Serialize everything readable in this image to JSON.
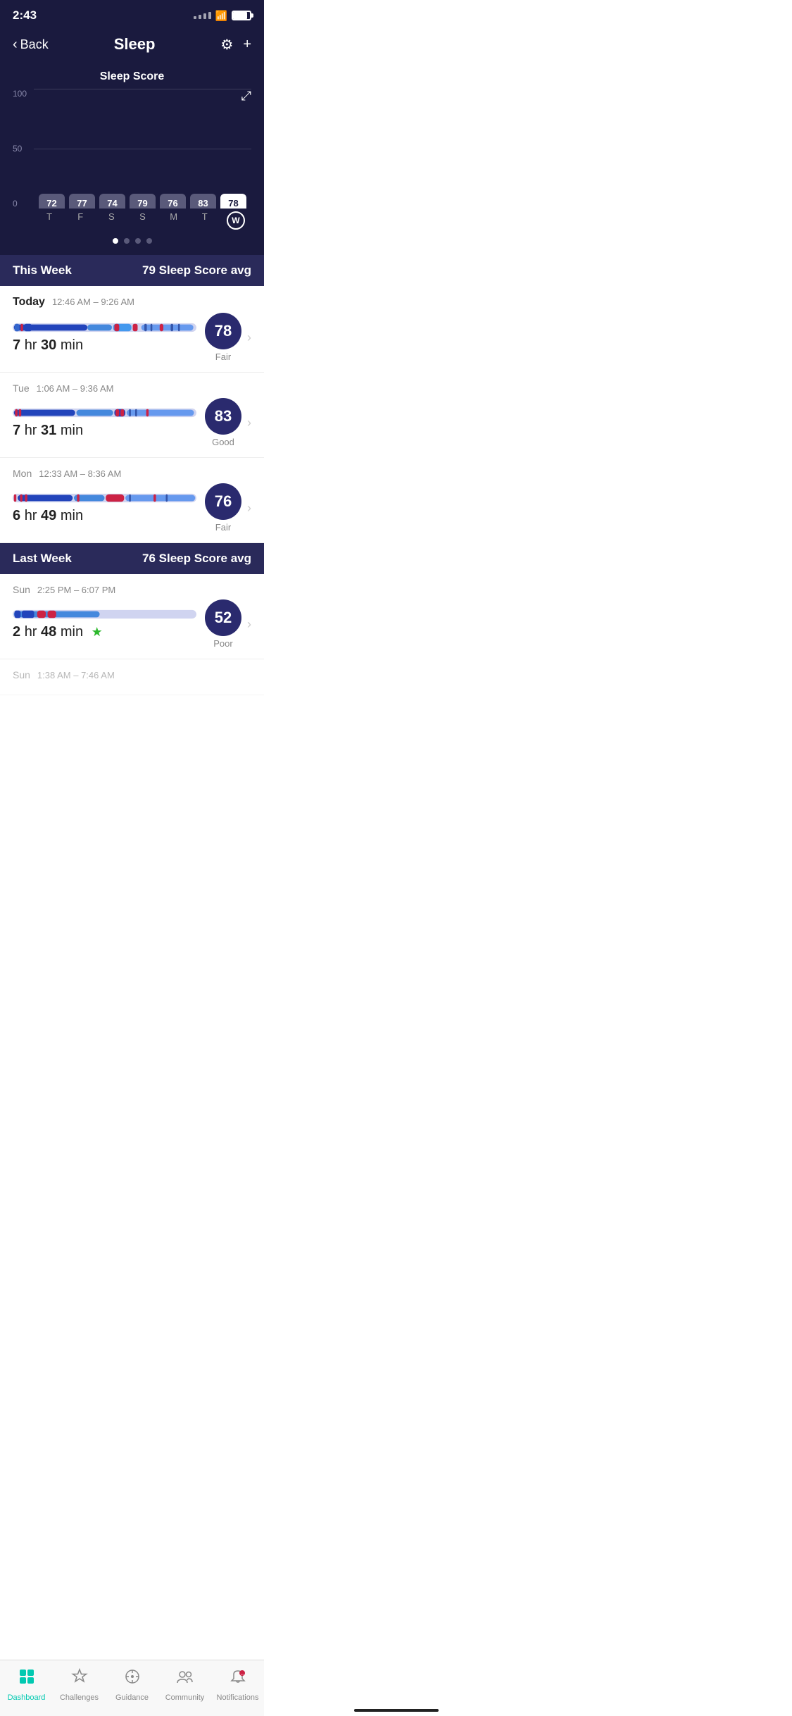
{
  "statusBar": {
    "time": "2:43",
    "batteryLevel": 85
  },
  "header": {
    "backLabel": "Back",
    "title": "Sleep",
    "gearIcon": "⚙",
    "plusIcon": "+"
  },
  "chart": {
    "title": "Sleep Score",
    "yLabels": [
      "100",
      "50",
      "0"
    ],
    "bars": [
      {
        "day": "T",
        "value": 72,
        "isToday": false
      },
      {
        "day": "F",
        "value": 77,
        "isToday": false
      },
      {
        "day": "S",
        "value": 74,
        "isToday": false
      },
      {
        "day": "S",
        "value": 79,
        "isToday": false
      },
      {
        "day": "M",
        "value": 76,
        "isToday": false
      },
      {
        "day": "T",
        "value": 83,
        "isToday": false
      },
      {
        "day": "W",
        "value": 78,
        "isToday": true
      }
    ],
    "maxValue": 100
  },
  "thisWeek": {
    "label": "This Week",
    "avgLabel": "79 Sleep Score avg"
  },
  "entries": [
    {
      "day": "Today",
      "dayStyle": "bold",
      "time": "12:46 AM – 9:26 AM",
      "duration": "7 hr 30 min",
      "hoursVal": "7",
      "minsVal": "30",
      "score": 78,
      "scoreLabel": "Fair",
      "hasStar": false
    },
    {
      "day": "Tue",
      "dayStyle": "normal",
      "time": "1:06 AM – 9:36 AM",
      "duration": "7 hr 31 min",
      "hoursVal": "7",
      "minsVal": "31",
      "score": 83,
      "scoreLabel": "Good",
      "hasStar": false
    },
    {
      "day": "Mon",
      "dayStyle": "normal",
      "time": "12:33 AM – 8:36 AM",
      "duration": "6 hr 49 min",
      "hoursVal": "6",
      "minsVal": "49",
      "score": 76,
      "scoreLabel": "Fair",
      "hasStar": false
    }
  ],
  "lastWeek": {
    "label": "Last Week",
    "avgLabel": "76 Sleep Score avg"
  },
  "lastWeekEntries": [
    {
      "day": "Sun",
      "dayStyle": "normal",
      "time": "2:25 PM – 6:07 PM",
      "duration": "2 hr 48 min",
      "hoursVal": "2",
      "minsVal": "48",
      "score": 52,
      "scoreLabel": "Poor",
      "hasStar": true
    },
    {
      "day": "Sun",
      "dayStyle": "normal",
      "time": "1:38 AM – 7:46 AM",
      "duration": "",
      "hoursVal": "",
      "minsVal": "",
      "score": null,
      "scoreLabel": "",
      "hasStar": false,
      "partial": true
    }
  ],
  "bottomNav": {
    "items": [
      {
        "id": "dashboard",
        "label": "Dashboard",
        "icon": "dashboard",
        "active": true
      },
      {
        "id": "challenges",
        "label": "Challenges",
        "icon": "star",
        "active": false
      },
      {
        "id": "guidance",
        "label": "Guidance",
        "icon": "compass",
        "active": false
      },
      {
        "id": "community",
        "label": "Community",
        "icon": "community",
        "active": false
      },
      {
        "id": "notifications",
        "label": "Notifications",
        "icon": "chat",
        "active": false
      }
    ]
  }
}
